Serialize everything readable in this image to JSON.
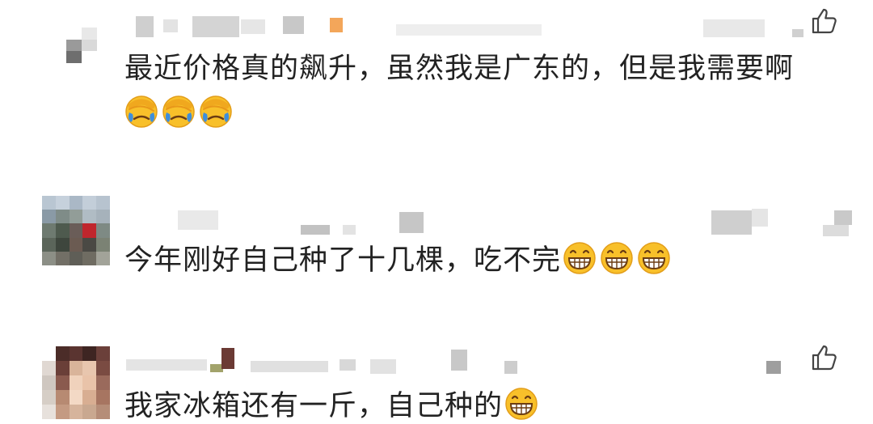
{
  "comments": [
    {
      "text": "最近价格真的飙升，虽然我是广东的，但是我需要啊",
      "emojis": [
        "facepalm-cry-emoji",
        "facepalm-cry-emoji",
        "facepalm-cry-emoji"
      ],
      "liked": false
    },
    {
      "text": "今年刚好自己种了十几棵，吃不完",
      "emojis": [
        "grin-emoji",
        "grin-emoji",
        "grin-emoji"
      ],
      "liked": false
    },
    {
      "text": "我家冰箱还有一斤，自己种的",
      "emojis": [
        "grin-emoji"
      ],
      "liked": false
    }
  ],
  "colors": {
    "text": "#222222",
    "icon": "#444444",
    "emoji_face": "#F8C02A",
    "emoji_tear": "#3E8EDB"
  }
}
